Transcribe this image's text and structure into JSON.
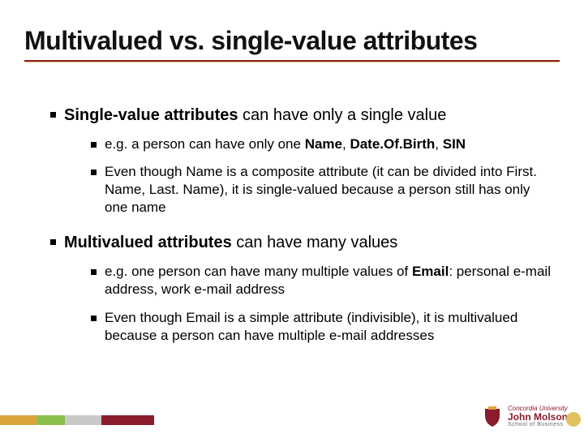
{
  "title": "Multivalued vs. single-value attributes",
  "bullets": [
    {
      "lead": "Single-value attributes",
      "rest": " can have only a single value",
      "sub": [
        {
          "pre": "e.g. a person can have only one ",
          "bolds": [
            "Name",
            "Date.Of.Birth",
            "SIN"
          ],
          "sep": ", ",
          "post": ""
        },
        {
          "pre": "Even though Name is a composite attribute (it can be divided into First. Name, Last. Name), it is single-valued because a person still has only one name",
          "bolds": [],
          "sep": "",
          "post": ""
        }
      ]
    },
    {
      "lead": "Multivalued attributes",
      "rest": " can have many values",
      "sub": [
        {
          "pre": "e.g. one person can have many multiple values of ",
          "bolds": [
            "Email"
          ],
          "sep": "",
          "post": ": personal e-mail address, work e-mail address"
        },
        {
          "pre": "Even though Email is a simple attribute (indivisible), it is multivalued because a person can have multiple e-mail addresses",
          "bolds": [],
          "sep": "",
          "post": ""
        }
      ]
    }
  ],
  "logo": {
    "line1": "Concordia University",
    "line2": "John Molson",
    "line3": "School of Business"
  }
}
